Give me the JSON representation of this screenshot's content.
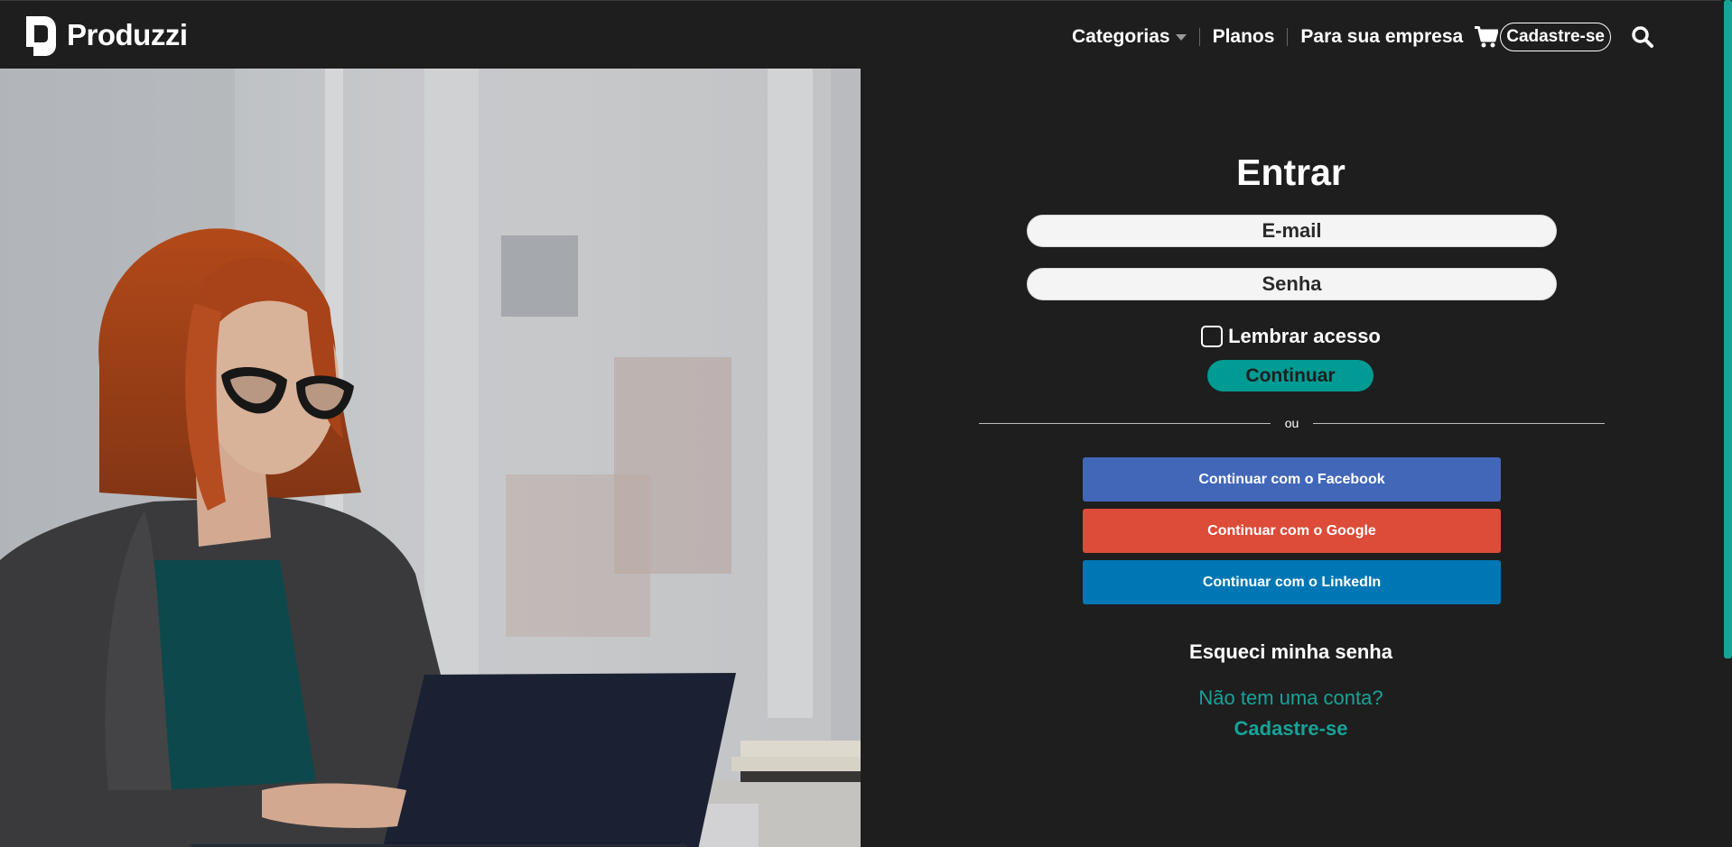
{
  "header": {
    "brand": "Produzzi",
    "nav": {
      "categories": "Categorias",
      "plans": "Planos",
      "business": "Para sua empresa",
      "signup": "Cadastre-se"
    },
    "icons": [
      "logo-mark-icon",
      "chevron-down-icon",
      "cart-icon",
      "search-icon"
    ]
  },
  "hero": {
    "alt": "Mulher ruiva de óculos usando notebook"
  },
  "login": {
    "title": "Entrar",
    "email_placeholder": "E-mail",
    "password_placeholder": "Senha",
    "remember_label": "Lembrar acesso",
    "remember_checked": false,
    "continue_label": "Continuar",
    "divider_text": "ou",
    "facebook_label": "Continuar com o Facebook",
    "google_label": "Continuar com o Google",
    "linkedin_label": "Continuar com o LinkedIn",
    "forgot_label": "Esqueci minha senha",
    "no_account_text": "Não tem uma conta?",
    "signup_link": "Cadastre-se"
  },
  "colors": {
    "background": "#1e1e1e",
    "accent": "#009b93",
    "accent_text": "#17a398",
    "facebook": "#4267b9",
    "google": "#dd4b39",
    "linkedin": "#0077b5"
  }
}
